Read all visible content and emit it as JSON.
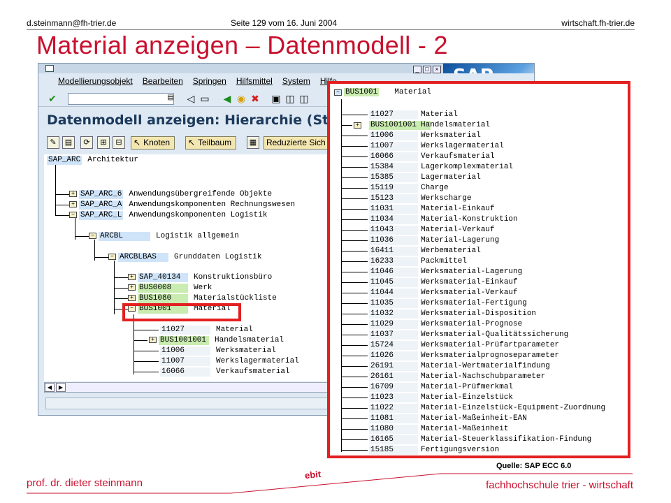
{
  "header": {
    "left": "d.steinmann@fh-trier.de",
    "center": "Seite 129 vom 16. Juni 2004",
    "right": "wirtschaft.fh-trier.de"
  },
  "slide_title": "Material anzeigen – Datenmodell - 2",
  "sap": {
    "logo": "SAP",
    "menu": [
      "Modellierungsobjekt",
      "Bearbeiten",
      "Springen",
      "Hilfsmittel",
      "System",
      "Hilfe"
    ],
    "window_title": "Datenmodell anzeigen: Hierarchie (Standarc",
    "toolbar_buttons": {
      "knoten": "Knoten",
      "teilbaum": "Teilbaum",
      "reduzierte": "Reduzierte Sich"
    },
    "tree": [
      {
        "key": "SAP_ARC",
        "desc": "Architektur",
        "color": "blue"
      },
      {
        "key": "SAP_ARC_6",
        "desc": "Anwendungsübergreifende Objekte",
        "color": "blue"
      },
      {
        "key": "SAP_ARC_A",
        "desc": "Anwendungskomponenten Rechnungswesen",
        "color": "blue"
      },
      {
        "key": "SAP_ARC_L",
        "desc": "Anwendungskomponenten Logistik",
        "color": "blue"
      },
      {
        "key": "ARCBL",
        "desc": "Logistik allgemein",
        "color": "blue"
      },
      {
        "key": "ARCBLBAS",
        "desc": "Grunddaten Logistik",
        "color": "blue"
      },
      {
        "key": "SAP_40134",
        "desc": "Konstruktionsbüro",
        "color": "blue"
      },
      {
        "key": "BUS0008",
        "desc": "Werk",
        "color": "green"
      },
      {
        "key": "BUS1080",
        "desc": "Materialstückliste",
        "color": "green"
      },
      {
        "key": "BUS1001",
        "desc": "Material",
        "color": "green"
      },
      {
        "key": "11027",
        "desc": "Material",
        "color": "none"
      },
      {
        "key": "BUS1001001",
        "desc": "Handelsmaterial",
        "color": "green"
      },
      {
        "key": "11006",
        "desc": "Werksmaterial",
        "color": "none"
      },
      {
        "key": "11007",
        "desc": "Werkslagermaterial",
        "color": "none"
      },
      {
        "key": "16066",
        "desc": "Verkaufsmaterial",
        "color": "none"
      }
    ]
  },
  "zoom": {
    "root": {
      "key": "BUS1001",
      "desc": "Material"
    },
    "rows": [
      {
        "key": "11027",
        "desc": "Material"
      },
      {
        "key": "BUS1001001",
        "desc": "Handelsmaterial"
      },
      {
        "key": "11006",
        "desc": "Werksmaterial"
      },
      {
        "key": "11007",
        "desc": "Werkslagermaterial"
      },
      {
        "key": "16066",
        "desc": "Verkaufsmaterial"
      },
      {
        "key": "15384",
        "desc": "Lagerkomplexmaterial"
      },
      {
        "key": "15385",
        "desc": "Lagermaterial"
      },
      {
        "key": "15119",
        "desc": "Charge"
      },
      {
        "key": "15123",
        "desc": "Werkscharge"
      },
      {
        "key": "11031",
        "desc": "Material-Einkauf"
      },
      {
        "key": "11034",
        "desc": "Material-Konstruktion"
      },
      {
        "key": "11043",
        "desc": "Material-Verkauf"
      },
      {
        "key": "11036",
        "desc": "Material-Lagerung"
      },
      {
        "key": "16411",
        "desc": "Werbematerial"
      },
      {
        "key": "16233",
        "desc": "Packmittel"
      },
      {
        "key": "11046",
        "desc": "Werksmaterial-Lagerung"
      },
      {
        "key": "11045",
        "desc": "Werksmaterial-Einkauf"
      },
      {
        "key": "11044",
        "desc": "Werksmaterial-Verkauf"
      },
      {
        "key": "11035",
        "desc": "Werksmaterial-Fertigung"
      },
      {
        "key": "11032",
        "desc": "Werksmaterial-Disposition"
      },
      {
        "key": "11029",
        "desc": "Werksmaterial-Prognose"
      },
      {
        "key": "11037",
        "desc": "Werksmaterial-Qualitätssicherung"
      },
      {
        "key": "15724",
        "desc": "Werksmaterial-Prüfartparameter"
      },
      {
        "key": "11026",
        "desc": "Werksmaterialprognoseparameter"
      },
      {
        "key": "26191",
        "desc": "Material-Wertmaterialfindung"
      },
      {
        "key": "26161",
        "desc": "Material-Nachschubparameter"
      },
      {
        "key": "16709",
        "desc": "Material-Prüfmerkmal"
      },
      {
        "key": "11023",
        "desc": "Material-Einzelstück"
      },
      {
        "key": "11022",
        "desc": "Material-Einzelstück-Equipment-Zuordnung"
      },
      {
        "key": "11081",
        "desc": "Material-Maßeinheit-EAN"
      },
      {
        "key": "11080",
        "desc": "Material-Maßeinheit"
      },
      {
        "key": "16165",
        "desc": "Material-Steuerklassifikation-Findung"
      },
      {
        "key": "15185",
        "desc": "Fertigungsversion"
      }
    ]
  },
  "source": "Quelle: SAP ECC 6.0",
  "footer": {
    "left": "prof. dr. dieter steinmann",
    "center": "ebit",
    "right": "fachhochschule trier - wirtschaft"
  },
  "colors": {
    "accent": "#c8102e",
    "highlight_box": "#e32020"
  }
}
